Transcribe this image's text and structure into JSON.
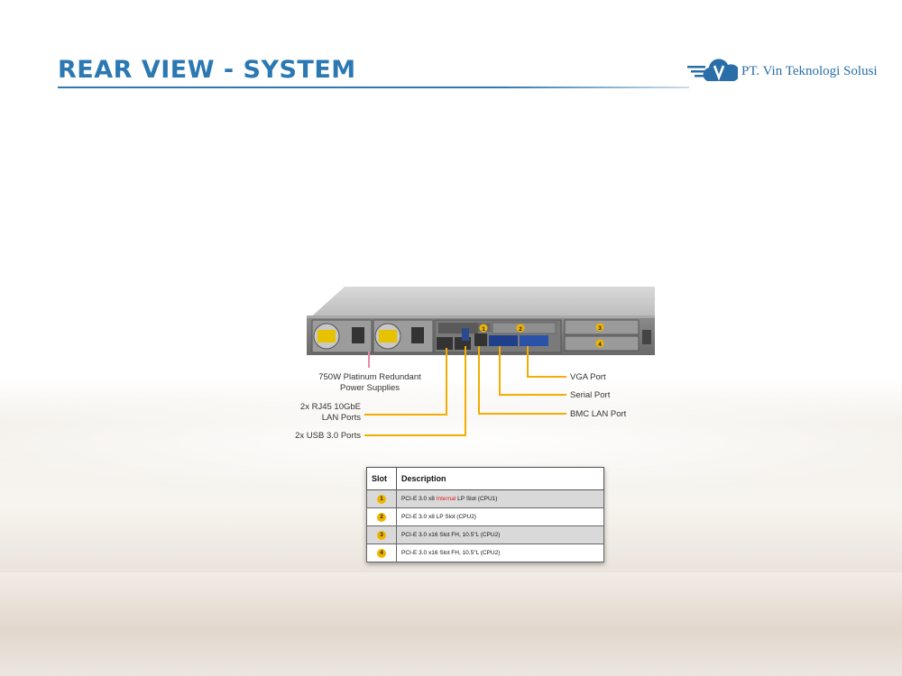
{
  "slide": {
    "title": "REAR VIEW - SYSTEM",
    "logo_text": "PT. Vin Teknologi Solusi"
  },
  "callouts": {
    "psu": {
      "line1": "750W Platinum Redundant",
      "line2": "Power Supplies"
    },
    "lan": {
      "line1": "2x RJ45 10GbE",
      "line2": "LAN Ports"
    },
    "usb": "2x USB 3.0 Ports",
    "vga": "VGA Port",
    "serial": "Serial Port",
    "bmc": "BMC LAN Port"
  },
  "slot_table": {
    "headers": [
      "Slot",
      "Description"
    ],
    "rows": [
      {
        "slot": "1",
        "desc_pre": "PCI-E 3.0 x8 ",
        "desc_highlight": "Internal",
        "desc_post": " LP Slot  (CPU1)"
      },
      {
        "slot": "2",
        "desc_pre": "PCI-E 3.0 x8 LP Slot (CPU2)",
        "desc_highlight": "",
        "desc_post": ""
      },
      {
        "slot": "3",
        "desc_pre": "PCI-E 3.0 x16 Slot FH, 10.5\"L (CPU2)",
        "desc_highlight": "",
        "desc_post": ""
      },
      {
        "slot": "4",
        "desc_pre": "PCI-E 3.0 x16 Slot FH, 10.5\"L (CPU2)",
        "desc_highlight": "",
        "desc_post": ""
      }
    ]
  },
  "server_slot_markers": [
    "1",
    "2",
    "3",
    "4"
  ],
  "colors": {
    "title_blue": "#2b78b3",
    "callout_orange": "#f2ad00",
    "slot_marker": "#f0b400",
    "highlight_red": "#e02020"
  }
}
